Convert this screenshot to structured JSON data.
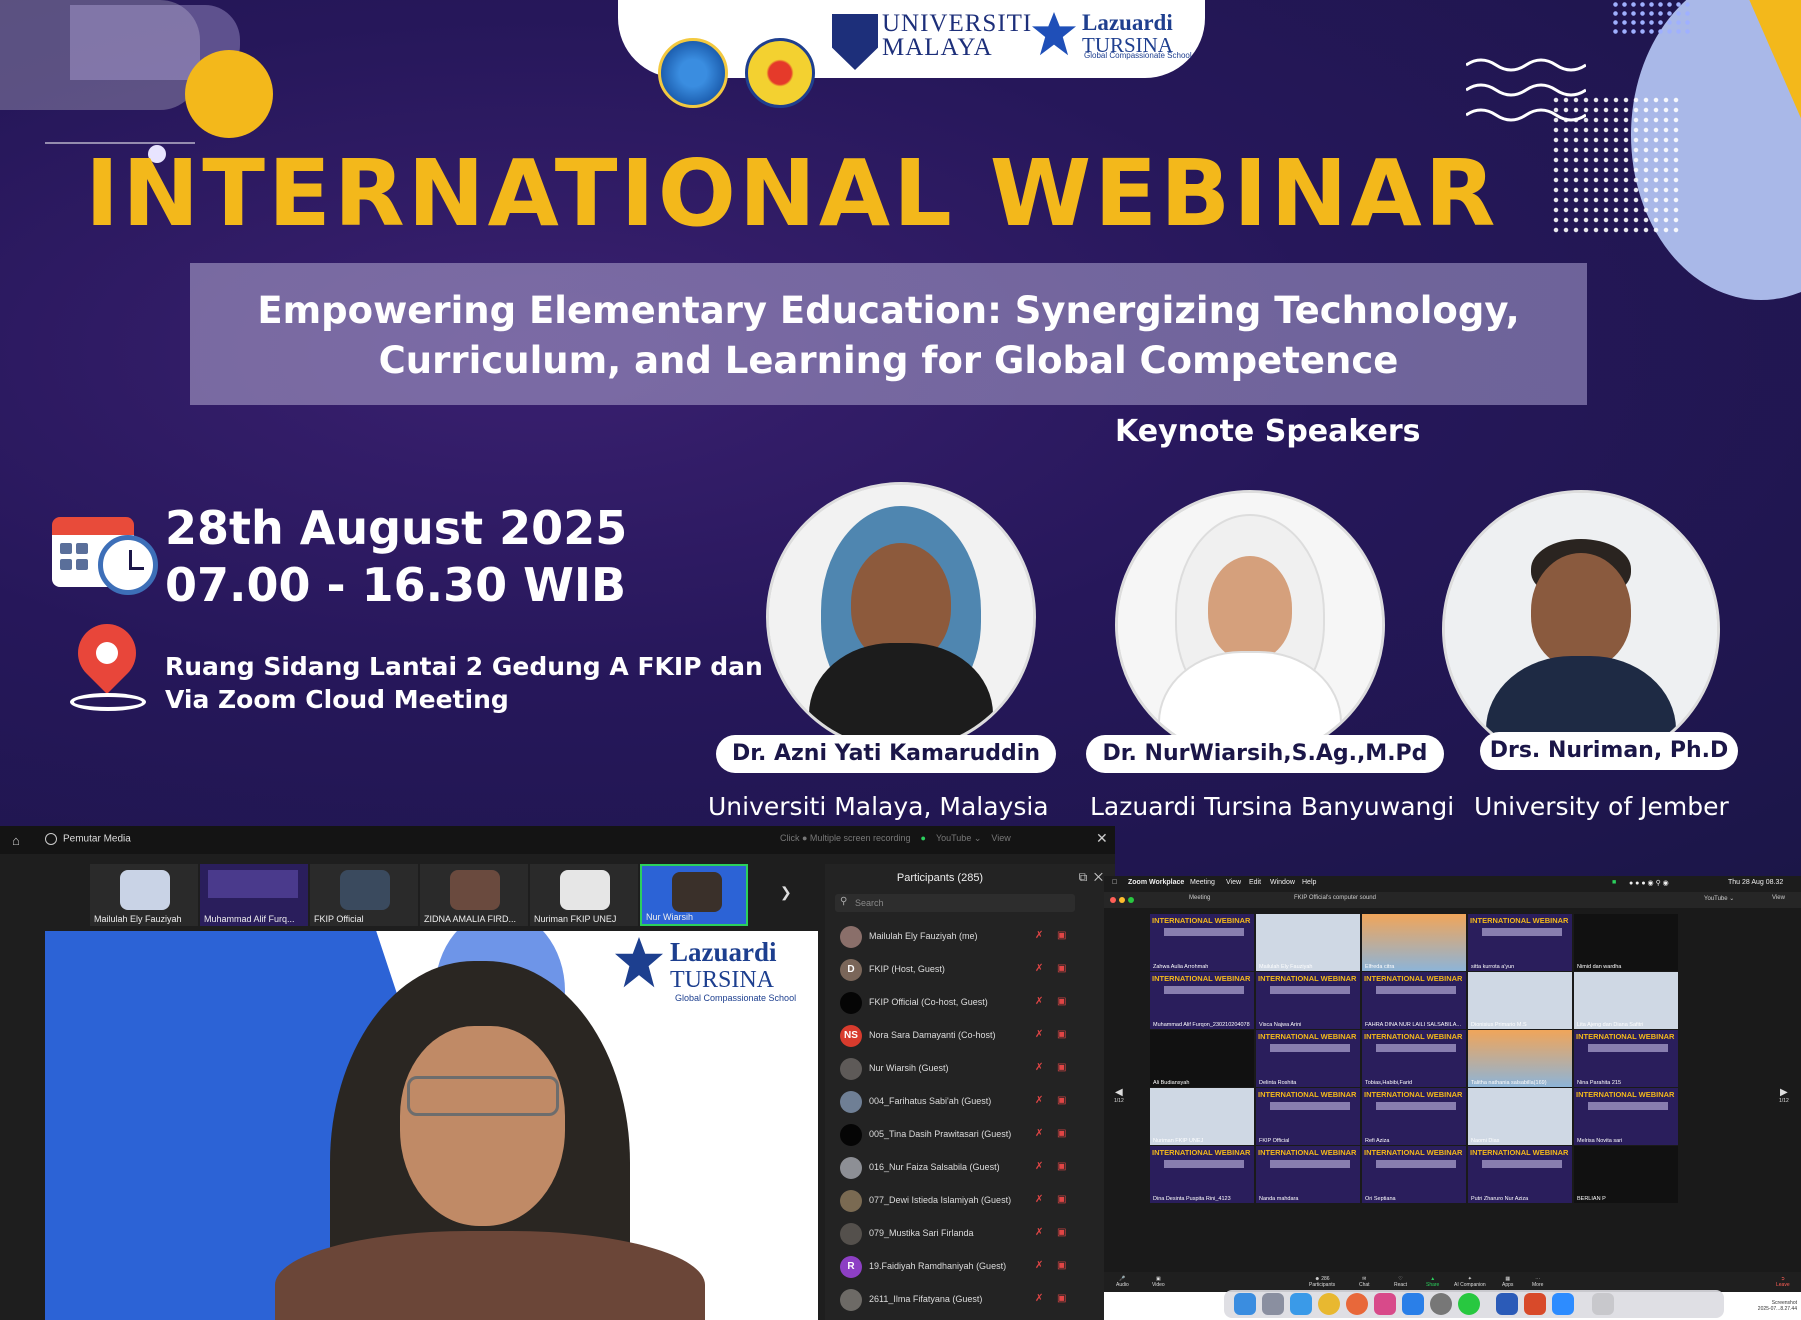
{
  "poster": {
    "logos": {
      "um_name": "UNIVERSITI\nMALAYA",
      "lazuardi_name": "Lazuardi",
      "lazuardi_sub": "TURSINA",
      "lazuardi_tag": "Global Compassionate School"
    },
    "title": "INTERNATIONAL WEBINAR",
    "subtitle_line1": "Empowering Elementary Education: Synergizing Technology,",
    "subtitle_line2": "Curriculum, and Learning for Global Competence",
    "keynote_heading": "Keynote Speakers",
    "date": "28th August 2025",
    "time": "07.00 - 16.30 WIB",
    "venue_line1": "Ruang Sidang Lantai 2 Gedung A FKIP dan",
    "venue_line2": "Via Zoom Cloud Meeting",
    "speakers": [
      {
        "name": "Dr. Azni Yati Kamaruddin",
        "affiliation": "Universiti Malaya, Malaysia"
      },
      {
        "name": "Dr. NurWiarsih,S.Ag.,M.Pd",
        "affiliation": "Lazuardi Tursina Banyuwangi"
      },
      {
        "name": "Drs. Nuriman, Ph.D",
        "affiliation": "University of Jember"
      }
    ]
  },
  "zoom_left": {
    "window_title": "Pemutar Media",
    "recording_note": "Click ● Multiple screen recording",
    "youtube_label": "YouTube ⌄",
    "view_label": "View",
    "thumbnails": [
      {
        "label": "Mailulah Ely Fauziyah"
      },
      {
        "label": "Muhammad Alif Furq..."
      },
      {
        "label": "FKIP Official"
      },
      {
        "label": "ZIDNA AMALIA FIRD..."
      },
      {
        "label": "Nuriman FKIP UNEJ"
      },
      {
        "label": "Nur Wiarsih"
      }
    ],
    "video_logo_name": "Lazuardi",
    "video_logo_sub": "TURSINA",
    "video_logo_tag": "Global Compassionate School",
    "participants_title": "Participants (285)",
    "search_placeholder": "Search",
    "participants": [
      {
        "name": "Mailulah Ely Fauziyah (me)",
        "initials": "",
        "color": "#8a6f6a"
      },
      {
        "name": "FKIP (Host, Guest)",
        "initials": "D",
        "color": "#7a6659"
      },
      {
        "name": "FKIP Official (Co-host, Guest)",
        "initials": "",
        "color": "#050505"
      },
      {
        "name": "Nora Sara Damayanti (Co-host)",
        "initials": "NS",
        "color": "#d83b2d"
      },
      {
        "name": "Nur Wiarsih (Guest)",
        "initials": "",
        "color": "#5e5a58"
      },
      {
        "name": "004_Farihatus Sabi'ah (Guest)",
        "initials": "",
        "color": "#6f7f95"
      },
      {
        "name": "005_Tina Dasih Prawitasari (Guest)",
        "initials": "",
        "color": "#050505"
      },
      {
        "name": "016_Nur Faiza Salsabila (Guest)",
        "initials": "",
        "color": "#8d8f95"
      },
      {
        "name": "077_Dewi Istieda Islamiyah (Guest)",
        "initials": "",
        "color": "#7a6a52"
      },
      {
        "name": "079_Mustika Sari Firlanda",
        "initials": "",
        "color": "#54504c"
      },
      {
        "name": "19.Faidiyah Ramdhaniyah (Guest)",
        "initials": "R",
        "color": "#8d3fc4"
      },
      {
        "name": "2611_Ilma Fifatyana (Guest)",
        "initials": "",
        "color": "#6d6a66"
      }
    ]
  },
  "mac_zoom": {
    "menubar": [
      "Zoom Workplace",
      "Meeting",
      "View",
      "Edit",
      "Window",
      "Help"
    ],
    "clock": "Thu 28 Aug 08.32",
    "window_label": "Meeting",
    "sound_label": "FKIP Official's computer sound",
    "youtube_label": "YouTube ⌄",
    "view_label": "View",
    "page_indicator": "1/12",
    "tile_title": "INTERNATIONAL WEBINAR",
    "tiles": [
      {
        "label": "Zahwa Aulia Arrohmah"
      },
      {
        "label": "Mailulah Ely Fauziyah"
      },
      {
        "label": "Elfreda citra"
      },
      {
        "label": "sitta kurrota a'yun"
      },
      {
        "label": "Nimid dan wardha"
      },
      {
        "label": "Muhammad Alif Furqon_230210204078"
      },
      {
        "label": "Visca Najwa Arini"
      },
      {
        "label": "FAHRA DINA NUR LAILI SALSABILA..."
      },
      {
        "label": "Dionisius Primario M.S"
      },
      {
        "label": "Lita Ajeng dan Diana Safitri"
      },
      {
        "label": "Ali Budiansyah"
      },
      {
        "label": "Delinta Roshita"
      },
      {
        "label": "Tobias,Habibi,Farid"
      },
      {
        "label": "Talitha nathania salsabilla(169)"
      },
      {
        "label": "Nina Parahita 215"
      },
      {
        "label": "Nuriman FKIP UNEJ"
      },
      {
        "label": "FKIP Official"
      },
      {
        "label": "Refi Aziza"
      },
      {
        "label": "Naomi Dias"
      },
      {
        "label": "Melrisa Novita sari"
      },
      {
        "label": "Dina Desinta Puspita Rini_4123"
      },
      {
        "label": "Nanda mahdara"
      },
      {
        "label": "Ori Septiana"
      },
      {
        "label": "Putri Zharuro Nur Aziza"
      },
      {
        "label": "BERLIAN P"
      }
    ],
    "toolbar": [
      "Audio",
      "Video",
      "Participants",
      "Chat",
      "React",
      "Share",
      "AI Companion",
      "Apps",
      "More",
      "Leave"
    ],
    "participants_count": "286",
    "screenshot_label": "Screenshot\n2025-07...8.27.44"
  }
}
